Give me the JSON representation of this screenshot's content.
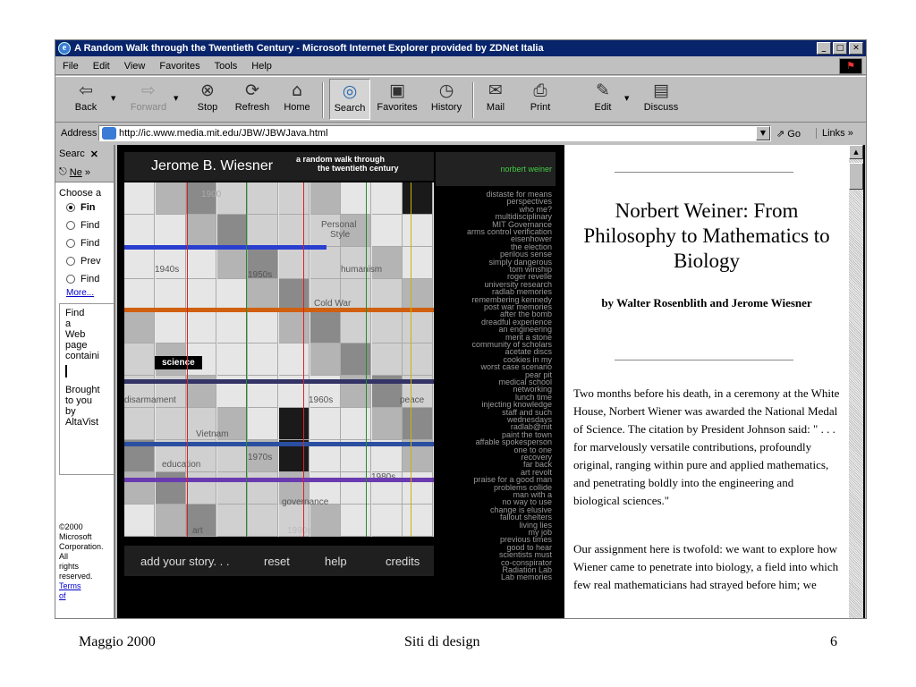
{
  "window": {
    "title": "A Random Walk through the Twentieth Century - Microsoft Internet Explorer provided by ZDNet Italia"
  },
  "menu": [
    "File",
    "Edit",
    "View",
    "Favorites",
    "Tools",
    "Help"
  ],
  "toolbar": {
    "back": "Back",
    "forward": "Forward",
    "stop": "Stop",
    "refresh": "Refresh",
    "home": "Home",
    "search": "Search",
    "favorites": "Favorites",
    "history": "History",
    "mail": "Mail",
    "print": "Print",
    "edit": "Edit",
    "discuss": "Discuss"
  },
  "address": {
    "label": "Address",
    "url": "http://ic.www.media.mit.edu/JBW/JBWJava.html",
    "go": "Go",
    "links": "Links"
  },
  "search_pane": {
    "title": "Searc",
    "new_label": "Ne",
    "choose": "Choose a",
    "options": [
      "Fin",
      "Find",
      "Find",
      "Prev",
      "Find"
    ],
    "more": "More...",
    "box_text": [
      "Find",
      "a",
      "Web",
      "page",
      "containi"
    ],
    "brought": [
      "Brought",
      "to you",
      "by",
      "AltaVist"
    ],
    "copyright": [
      "©2000",
      "Microsoft",
      "Corporation.",
      "All",
      "rights",
      "reserved."
    ],
    "terms": [
      "Terms",
      "of"
    ]
  },
  "applet": {
    "name": "Jerome B. Wiesner",
    "tagline1": "a random walk through",
    "tagline2": "the twentieth century",
    "grid_labels": {
      "y1900": "1900",
      "personal": "Personal",
      "style": "Style",
      "y1940s": "1940s",
      "y1950s": "1950s",
      "humanism": "humanism",
      "coldwar": "Cold War",
      "science": "science",
      "disarmament": "disarmament",
      "y1960s": "1960s",
      "peace": "peace",
      "vietnam": "Vietnam",
      "education": "education",
      "y1970s": "1970s",
      "y1980s": "1980s",
      "governance": "governance",
      "art": "art",
      "y1990s": "1990s"
    },
    "bottom": {
      "add": "add your story. . .",
      "reset": "reset",
      "help": "help",
      "credits": "credits"
    },
    "topics_header": "norbert weiner",
    "topics": [
      "distaste for means",
      "perspectives",
      "who me?",
      "multidisciplinary",
      "MIT Governance",
      "arms control verification",
      "eisenhower",
      "the election",
      "perilous sense",
      "simply dangerous",
      "tom winship",
      "roger revelle",
      "university research",
      "radlab memories",
      "remembering kennedy",
      "post war memories",
      "after the bomb",
      "dreadful experience",
      "an engineering",
      "merit a stone",
      "community of scholars",
      "acetate discs",
      "cookies in my",
      "worst case scenario",
      "pear pit",
      "medical school",
      "networking",
      "lunch time",
      "injecting knowledge",
      "staff and such",
      "wednesdays",
      "radlab@mit",
      "paint the town",
      "affable spokesperson",
      "one to one",
      "recovery",
      "far back",
      "art revolt",
      "praise for a good man",
      "problems collide",
      "man with a",
      "no way to use",
      "change is elusive",
      "fallout shelters",
      "living lies",
      "my job",
      "previous times",
      "good to hear",
      "scientists must",
      "co-conspirator",
      "Radiation Lab",
      "Lab memories"
    ]
  },
  "article": {
    "title": "Norbert Weiner: From Philosophy to Mathematics to Biology",
    "byline": "by Walter Rosenblith and Jerome Wiesner",
    "p1": "Two months before his death, in a ceremony at the White House, Norbert Wiener was awarded the National Medal of Science. The citation by President Johnson said: \" . . . for marvelously versatile contributions, profoundly original, ranging within pure and applied mathematics, and penetrating boldly into the engineering and biological sciences.\"",
    "p2": "Our assignment here is twofold: we want to explore how Wiener came to penetrate into biology, a field into which few real mathematicians had strayed before him; we"
  },
  "slide": {
    "left": "Maggio 2000",
    "center": "Siti di design",
    "right": "6"
  }
}
